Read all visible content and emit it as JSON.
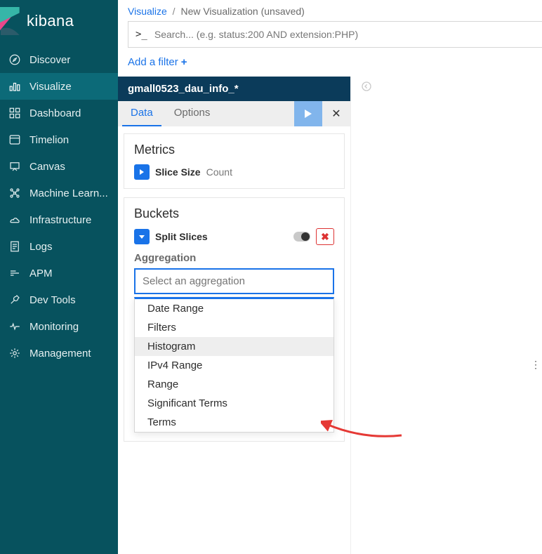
{
  "brand": {
    "name": "kibana"
  },
  "nav": [
    {
      "id": "discover",
      "label": "Discover"
    },
    {
      "id": "visualize",
      "label": "Visualize"
    },
    {
      "id": "dashboard",
      "label": "Dashboard"
    },
    {
      "id": "timelion",
      "label": "Timelion"
    },
    {
      "id": "canvas",
      "label": "Canvas"
    },
    {
      "id": "ml",
      "label": "Machine Learn..."
    },
    {
      "id": "infrastructure",
      "label": "Infrastructure"
    },
    {
      "id": "logs",
      "label": "Logs"
    },
    {
      "id": "apm",
      "label": "APM"
    },
    {
      "id": "devtools",
      "label": "Dev Tools"
    },
    {
      "id": "monitoring",
      "label": "Monitoring"
    },
    {
      "id": "management",
      "label": "Management"
    }
  ],
  "activeNav": "visualize",
  "breadcrumbs": {
    "root": "Visualize",
    "current": "New Visualization (unsaved)"
  },
  "search": {
    "placeholder": "Search... (e.g. status:200 AND extension:PHP)"
  },
  "filter": {
    "add_label": "Add a filter"
  },
  "index_pattern": "gmall0523_dau_info_*",
  "tabs": {
    "data": "Data",
    "options": "Options"
  },
  "metrics": {
    "title": "Metrics",
    "row": {
      "label": "Slice Size",
      "meta": "Count"
    }
  },
  "buckets": {
    "title": "Buckets",
    "row": {
      "label": "Split Slices"
    },
    "aggregation_label": "Aggregation",
    "aggregation_placeholder": "Select an aggregation",
    "options": [
      "Date Range",
      "Filters",
      "Histogram",
      "IPv4 Range",
      "Range",
      "Significant Terms",
      "Terms"
    ],
    "hovered_option_index": 2
  }
}
